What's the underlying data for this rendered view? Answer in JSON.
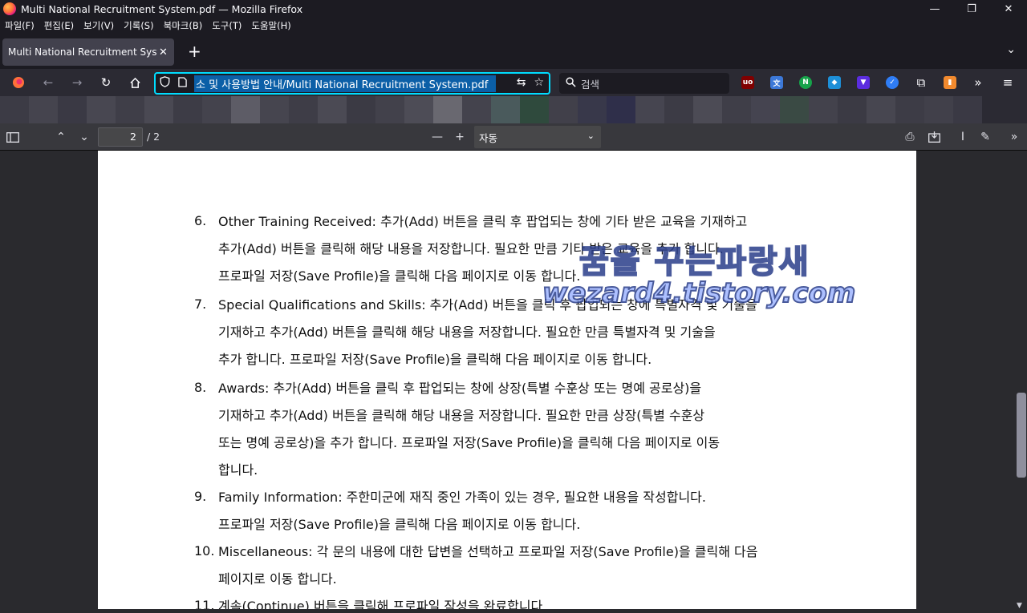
{
  "window": {
    "title": "Multi National Recruitment System.pdf — Mozilla Firefox",
    "controls": {
      "minimize": "—",
      "maximize": "❐",
      "close": "✕"
    }
  },
  "menu": [
    "파일(F)",
    "편집(E)",
    "보기(V)",
    "기록(S)",
    "북마크(B)",
    "도구(T)",
    "도움말(H)"
  ],
  "tab": {
    "title": "Multi National Recruitment System.pdf",
    "close": "✕",
    "new_tab": "+",
    "list_all": "⌄"
  },
  "nav": {
    "url": "소 및 사용방법 안내/Multi National Recruitment System.pdf",
    "search_placeholder": "검색"
  },
  "pdf_toolbar": {
    "page_number": "2",
    "page_total": "/ 2",
    "zoom": "자동"
  },
  "document": {
    "items": [
      {
        "num": "6.",
        "lines": [
          "Other Training Received: 추가(Add) 버튼을 클릭 후 팝업되는 창에 기타 받은 교육을 기재하고",
          "추가(Add) 버튼을 클릭해 해당 내용을 저장합니다. 필요한 만큼 기타 받은 교육을 추가 합니다.",
          "프로파일 저장(Save Profile)을 클릭해 다음 페이지로 이동 합니다."
        ]
      },
      {
        "num": "7.",
        "lines": [
          "Special Qualifications and Skills: 추가(Add) 버튼을 클릭 후 팝업되는 창에 특별자격 및 기술을",
          "기재하고 추가(Add) 버튼을 클릭해 해당 내용을 저장합니다. 필요한 만큼 특별자격 및 기술을",
          "추가 합니다. 프로파일 저장(Save Profile)을 클릭해 다음 페이지로 이동 합니다."
        ]
      },
      {
        "num": "8.",
        "lines": [
          "Awards: 추가(Add) 버튼을 클릭 후 팝업되는 창에 상장(특별 수훈상 또는 명예 공로상)을",
          "기재하고 추가(Add) 버튼을 클릭해 해당 내용을 저장합니다. 필요한 만큼 상장(특별 수훈상",
          "또는 명예 공로상)을 추가 합니다. 프로파일 저장(Save Profile)을 클릭해 다음 페이지로 이동",
          "합니다."
        ]
      },
      {
        "num": "9.",
        "lines": [
          "Family Information: 주한미군에 재직 중인 가족이 있는 경우, 필요한 내용을 작성합니다.",
          "프로파일 저장(Save Profile)을 클릭해 다음 페이지로 이동 합니다."
        ]
      },
      {
        "num": "10.",
        "lines": [
          "Miscellaneous: 각 문의 내용에 대한 답변을 선택하고 프로파일 저장(Save Profile)을 클릭해 다음",
          "페이지로 이동 합니다."
        ]
      },
      {
        "num": "11.",
        "lines": [
          "계속(Continue) 버튼을 클릭해 프로파일 작성을 완료합니다."
        ]
      }
    ]
  },
  "watermark": {
    "line1": "꿈을 꾸는파랑새",
    "line2": "wezard4.tistory.com"
  }
}
